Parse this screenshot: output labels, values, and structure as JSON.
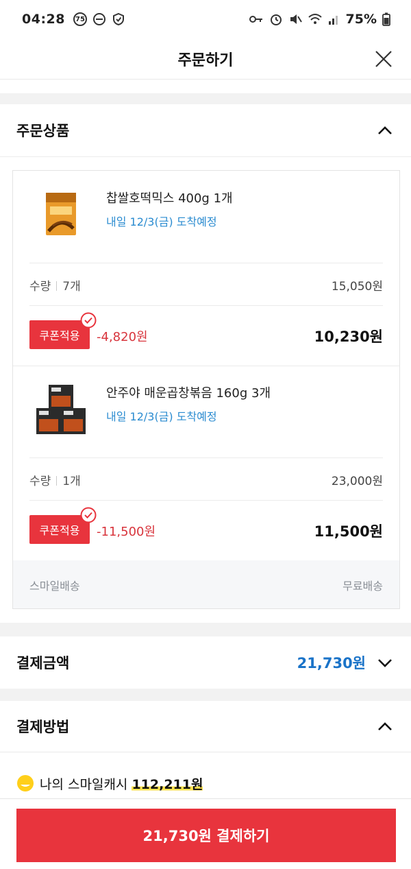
{
  "status_bar": {
    "time": "04:28",
    "badge": "75",
    "battery": "75%"
  },
  "header": {
    "title": "주문하기"
  },
  "order_section": {
    "title": "주문상품",
    "items": [
      {
        "name": "찹쌀호떡믹스 400g 1개",
        "delivery": "내일 12/3(금) 도착예정",
        "qty_label": "수량",
        "qty": "7개",
        "subtotal": "15,050원",
        "coupon_label": "쿠폰적용",
        "discount": "-4,820원",
        "final": "10,230원"
      },
      {
        "name": "안주야 매운곱창볶음 160g 3개",
        "delivery": "내일 12/3(금) 도착예정",
        "qty_label": "수량",
        "qty": "1개",
        "subtotal": "23,000원",
        "coupon_label": "쿠폰적용",
        "discount": "-11,500원",
        "final": "11,500원"
      }
    ],
    "shipping": {
      "method": "스마일배송",
      "fee": "무료배송"
    }
  },
  "payment_amount": {
    "title": "결제금액",
    "amount": "21,730원"
  },
  "payment_method": {
    "title": "결제방법",
    "cash_label": "나의 스마일캐시",
    "cash_amount": "112,211원"
  },
  "pay_button": {
    "label": "21,730원 결제하기"
  },
  "colors": {
    "accent_red": "#e8343d",
    "link_blue": "#2a8bd0",
    "amount_blue": "#1a73c8",
    "highlight_yellow": "#ffe34f"
  }
}
